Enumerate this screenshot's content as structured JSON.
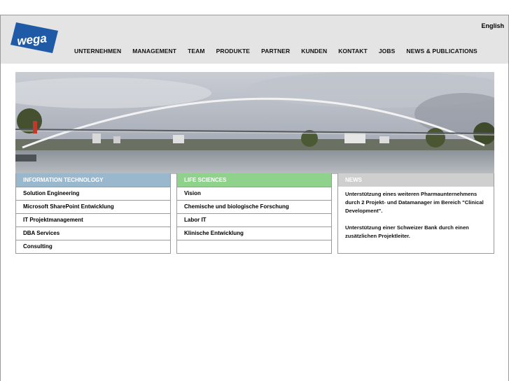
{
  "header": {
    "logo_text": "wega",
    "language_link": "English",
    "nav": [
      "UNTERNEHMEN",
      "MANAGEMENT",
      "TEAM",
      "PRODUKTE",
      "PARTNER",
      "KUNDEN",
      "KONTAKT",
      "JOBS",
      "NEWS & PUBLICATIONS"
    ]
  },
  "columns": {
    "it": {
      "title": "INFORMATION TECHNOLOGY",
      "items": [
        "Solution Engineering",
        "Microsoft SharePoint Entwicklung",
        "IT Projektmanagement",
        "DBA Services",
        "Consulting"
      ]
    },
    "ls": {
      "title": "LIFE SCIENCES",
      "items": [
        "Vision",
        "Chemische und biologische Forschung",
        "Labor IT",
        "Klinische Entwicklung"
      ]
    },
    "news": {
      "title": "NEWS",
      "items": [
        "Unterstützung eines weiteren Pharmaunternehmens durch 2 Projekt- und Datamanager im Bereich \"Clinical Development\".",
        "Unterstützung einer Schweizer Bank durch einen zusätzlichen Projektleiter."
      ]
    }
  },
  "colors": {
    "header_bg": "#e4e4e4",
    "logo_blue": "#1f5aa6",
    "it_header": "#9ab8cd",
    "ls_header": "#8fd28c",
    "news_header": "#cfcfcf"
  }
}
